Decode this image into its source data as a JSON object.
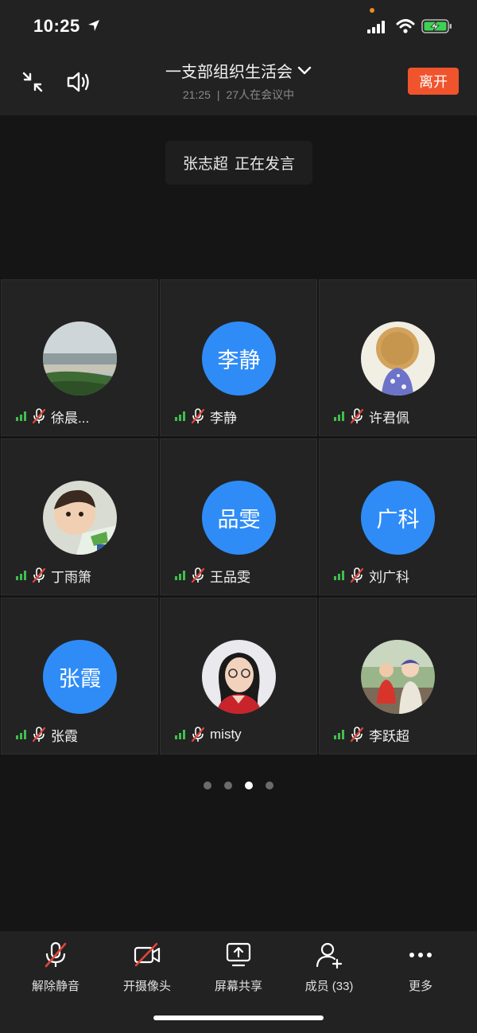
{
  "status_bar": {
    "time": "10:25"
  },
  "header": {
    "title": "一支部组织生活会",
    "duration": "21:25",
    "participants": "27人在会议中",
    "leave_label": "离开"
  },
  "speaking_toast": {
    "speaker": "张志超",
    "status": "正在发言"
  },
  "participants": [
    {
      "name": "徐晨...",
      "avatar_type": "photo-landscape",
      "muted": true
    },
    {
      "name": "李静",
      "avatar_type": "text",
      "avatar_text": "李静",
      "muted": true
    },
    {
      "name": "许君佩",
      "avatar_type": "photo-hat",
      "muted": true
    },
    {
      "name": "丁雨箫",
      "avatar_type": "photo-child",
      "muted": true
    },
    {
      "name": "王品雯",
      "avatar_type": "text",
      "avatar_text": "品雯",
      "muted": true
    },
    {
      "name": "刘广科",
      "avatar_type": "text",
      "avatar_text": "广科",
      "muted": true
    },
    {
      "name": "张霞",
      "avatar_type": "text",
      "avatar_text": "张霞",
      "muted": true
    },
    {
      "name": "misty",
      "avatar_type": "photo-woman",
      "muted": true
    },
    {
      "name": "李跃超",
      "avatar_type": "photo-family",
      "muted": true
    }
  ],
  "pager": {
    "total": 4,
    "active_index": 2
  },
  "toolbar": {
    "unmute": "解除静音",
    "camera": "开摄像头",
    "share": "屏幕共享",
    "members": "成员 (33)",
    "more": "更多"
  },
  "colors": {
    "accent_blue": "#2f8cf7",
    "leave_orange": "#f0542d",
    "signal_green": "#3fbf4e",
    "mute_red": "#e0463a"
  }
}
